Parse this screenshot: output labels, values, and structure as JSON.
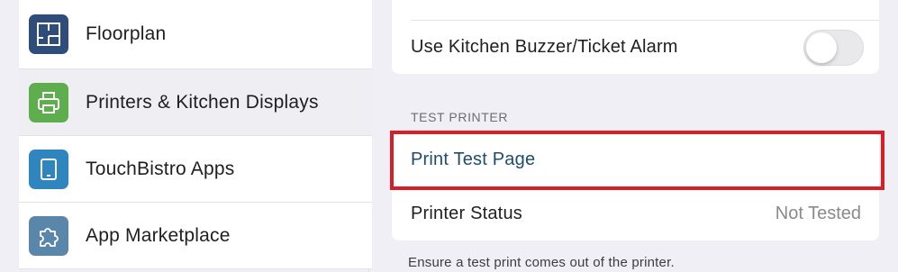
{
  "sidebar": {
    "items": [
      {
        "label": "Floorplan",
        "icon": "floorplan-icon",
        "color": "#2e4d7a",
        "selected": false
      },
      {
        "label": "Printers & Kitchen Displays",
        "icon": "printer-icon",
        "color": "#5fae4e",
        "selected": true
      },
      {
        "label": "TouchBistro Apps",
        "icon": "tablet-icon",
        "color": "#2f86bf",
        "selected": false
      },
      {
        "label": "App Marketplace",
        "icon": "puzzle-icon",
        "color": "#5a86aa",
        "selected": false
      }
    ]
  },
  "detail": {
    "top_card": {
      "kitchen_buzzer": {
        "label": "Use Kitchen Buzzer/Ticket Alarm",
        "enabled": false
      }
    },
    "test_printer": {
      "header": "TEST PRINTER",
      "print_test_label": "Print Test Page",
      "status_label": "Printer Status",
      "status_value": "Not Tested",
      "footnote": "Ensure a test print comes out of the printer."
    }
  },
  "colors": {
    "highlight": "#d81e26",
    "link": "#1c4e6c",
    "background": "#f0eff5"
  }
}
